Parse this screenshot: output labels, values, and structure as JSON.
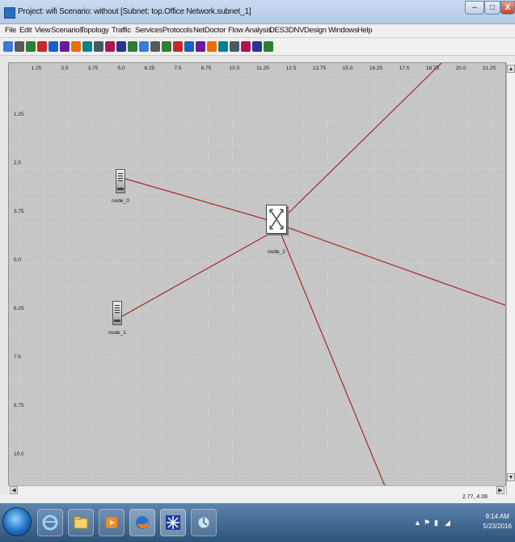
{
  "window": {
    "title": "Project: wifi Scenario: without  [Subnet: top.Office Network.subnet_1]",
    "min_label": "–",
    "max_label": "□",
    "close_label": "X"
  },
  "menu": [
    "File",
    "Edit",
    "View",
    "Scenarios",
    "Topology",
    "Traffic",
    "Services",
    "Protocols",
    "NetDoctor",
    "Flow Analysis",
    "DES",
    "3DNV",
    "Design",
    "Windows",
    "Help"
  ],
  "toolbar_icons": [
    "open-icon",
    "save-icon",
    "print-icon",
    "import-icon",
    "model-icon",
    "palette-icon",
    "object-icon",
    "zoom-in-icon",
    "zoom-out-icon",
    "node-icon",
    "link-icon",
    "link-icon-2",
    "check-icon",
    "tree-icon",
    "stat-icon",
    "grid-icon",
    "table-icon",
    "flow-icon",
    "wand-icon",
    "dashboard-icon",
    "graph-icon",
    "config-icon",
    "report-icon",
    "export-icon"
  ],
  "ruler": {
    "x_ticks": [
      "1.25",
      "2.5",
      "3.75",
      "5.0",
      "6.25",
      "7.5",
      "8.75",
      "10.0",
      "11.25",
      "12.5",
      "13.75",
      "15.0",
      "16.25",
      "17.5",
      "18.75",
      "20.0",
      "21.25"
    ],
    "y_ticks": [
      "1.25",
      "2.5",
      "3.75",
      "5.0",
      "6.25",
      "7.5",
      "8.75",
      "10.0"
    ]
  },
  "nodes": {
    "node_0": "node_0",
    "node_1": "node_1",
    "node_2": "node_2"
  },
  "colors": {
    "link": "#a52a2a",
    "workspace": "#c6c6c6"
  },
  "status": {
    "coords": "2.77, 4.08"
  },
  "taskbar": {
    "time": "9:14 AM",
    "date": "5/23/2016"
  }
}
